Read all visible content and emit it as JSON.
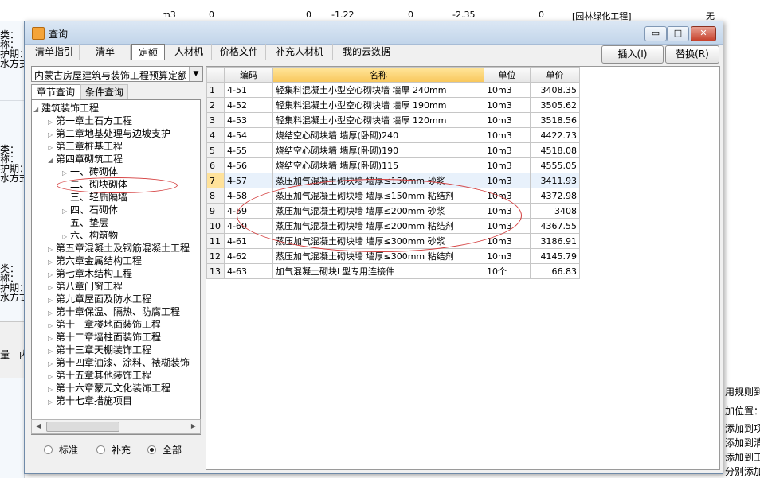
{
  "background": {
    "top_row": {
      "unit": "m3",
      "v1": "0",
      "v2": "0",
      "v3": "-1.22",
      "v4": "0",
      "v5": "-2.35",
      "v6": "0",
      "category": "[园林绿化工程]",
      "flag": "无"
    },
    "left_labels": [
      "类：",
      "称：",
      "护期：",
      "水方式",
      "类：",
      "称：",
      "护期：",
      "水方式",
      "类：",
      "称：",
      "护期：",
      "水方式"
    ],
    "bottom_labels": [
      "量",
      "内"
    ],
    "right_labels": [
      "用规则到所",
      "加位置：",
      "添加到项",
      "添加到清",
      "添加到工",
      "分别添加"
    ]
  },
  "dialog": {
    "title": "查询",
    "window_buttons": {
      "minimize": "▭",
      "maximize": "□",
      "close": "✕"
    },
    "tabs": [
      {
        "label": "清单指引"
      },
      {
        "label": "清单"
      },
      {
        "label": "定额"
      },
      {
        "label": "人材机"
      },
      {
        "label": "价格文件"
      },
      {
        "label": "补充人材机"
      },
      {
        "label": "我的云数据"
      }
    ],
    "insert_button": "插入(I)",
    "replace_button": "替换(R)",
    "quota_library": "内蒙古房屋建筑与装饰工程预算定额",
    "subtabs": {
      "chapter": "章节查询",
      "condition": "条件查询"
    },
    "tree": [
      {
        "label": "建筑装饰工程",
        "level": 0,
        "expand": "◢"
      },
      {
        "label": "第一章土石方工程",
        "level": 1,
        "expand": "▷"
      },
      {
        "label": "第二章地基处理与边坡支护",
        "level": 1,
        "expand": "▷"
      },
      {
        "label": "第三章桩基工程",
        "level": 1,
        "expand": "▷"
      },
      {
        "label": "第四章砌筑工程",
        "level": 1,
        "expand": "◢"
      },
      {
        "label": "一、砖砌体",
        "level": 2,
        "expand": "▷"
      },
      {
        "label": "二、砌块砌体",
        "level": 2,
        "expand": ""
      },
      {
        "label": "三、轻质隔墙",
        "level": 2,
        "expand": ""
      },
      {
        "label": "四、石砌体",
        "level": 2,
        "expand": "▷"
      },
      {
        "label": "五、垫层",
        "level": 2,
        "expand": ""
      },
      {
        "label": "六、构筑物",
        "level": 2,
        "expand": "▷"
      },
      {
        "label": "第五章混凝土及钢筋混凝土工程",
        "level": 1,
        "expand": "▷"
      },
      {
        "label": "第六章金属结构工程",
        "level": 1,
        "expand": "▷"
      },
      {
        "label": "第七章木结构工程",
        "level": 1,
        "expand": "▷"
      },
      {
        "label": "第八章门窗工程",
        "level": 1,
        "expand": "▷"
      },
      {
        "label": "第九章屋面及防水工程",
        "level": 1,
        "expand": "▷"
      },
      {
        "label": "第十章保温、隔热、防腐工程",
        "level": 1,
        "expand": "▷"
      },
      {
        "label": "第十一章楼地面装饰工程",
        "level": 1,
        "expand": "▷"
      },
      {
        "label": "第十二章墙柱面装饰工程",
        "level": 1,
        "expand": "▷"
      },
      {
        "label": "第十三章天棚装饰工程",
        "level": 1,
        "expand": "▷"
      },
      {
        "label": "第十四章油漆、涂料、裱糊装饰",
        "level": 1,
        "expand": "▷"
      },
      {
        "label": "第十五章其他装饰工程",
        "level": 1,
        "expand": "▷"
      },
      {
        "label": "第十六章蒙元文化装饰工程",
        "level": 1,
        "expand": "▷"
      },
      {
        "label": "第十七章措施项目",
        "level": 1,
        "expand": "▷"
      }
    ],
    "radios": [
      {
        "label": "标准",
        "checked": false
      },
      {
        "label": "补充",
        "checked": false
      },
      {
        "label": "全部",
        "checked": true
      }
    ],
    "grid": {
      "columns": [
        "",
        "编码",
        "名称",
        "单位",
        "单价"
      ],
      "rows": [
        {
          "n": "1",
          "code": "4-51",
          "name": "轻集料混凝土小型空心砌块墙 墙厚 240mm",
          "unit": "10m3",
          "price": "3408.35"
        },
        {
          "n": "2",
          "code": "4-52",
          "name": "轻集料混凝土小型空心砌块墙 墙厚 190mm",
          "unit": "10m3",
          "price": "3505.62"
        },
        {
          "n": "3",
          "code": "4-53",
          "name": "轻集料混凝土小型空心砌块墙 墙厚 120mm",
          "unit": "10m3",
          "price": "3518.56"
        },
        {
          "n": "4",
          "code": "4-54",
          "name": "烧结空心砌块墙 墙厚(卧砌)240",
          "unit": "10m3",
          "price": "4422.73"
        },
        {
          "n": "5",
          "code": "4-55",
          "name": "烧结空心砌块墙 墙厚(卧砌)190",
          "unit": "10m3",
          "price": "4518.08"
        },
        {
          "n": "6",
          "code": "4-56",
          "name": "烧结空心砌块墙 墙厚(卧砌)115",
          "unit": "10m3",
          "price": "4555.05"
        },
        {
          "n": "7",
          "code": "4-57",
          "name": "蒸压加气混凝土砌块墙 墙厚≤150mm 砂浆",
          "unit": "10m3",
          "price": "3411.93"
        },
        {
          "n": "8",
          "code": "4-58",
          "name": "蒸压加气混凝土砌块墙 墙厚≤150mm 粘结剂",
          "unit": "10m3",
          "price": "4372.98"
        },
        {
          "n": "9",
          "code": "4-59",
          "name": "蒸压加气混凝土砌块墙 墙厚≤200mm 砂浆",
          "unit": "10m3",
          "price": "3408"
        },
        {
          "n": "10",
          "code": "4-60",
          "name": "蒸压加气混凝土砌块墙 墙厚≤200mm 粘结剂",
          "unit": "10m3",
          "price": "4367.55"
        },
        {
          "n": "11",
          "code": "4-61",
          "name": "蒸压加气混凝土砌块墙 墙厚≤300mm 砂浆",
          "unit": "10m3",
          "price": "3186.91"
        },
        {
          "n": "12",
          "code": "4-62",
          "name": "蒸压加气混凝土砌块墙 墙厚≤300mm 粘结剂",
          "unit": "10m3",
          "price": "4145.79"
        },
        {
          "n": "13",
          "code": "4-63",
          "name": "加气混凝土砌块L型专用连接件",
          "unit": "10个",
          "price": "66.83"
        }
      ]
    },
    "accent_colors": {
      "sorted_header": "#f8c65a",
      "selected_row": "#e8f1fb",
      "annotation": "#d43c3c"
    }
  }
}
